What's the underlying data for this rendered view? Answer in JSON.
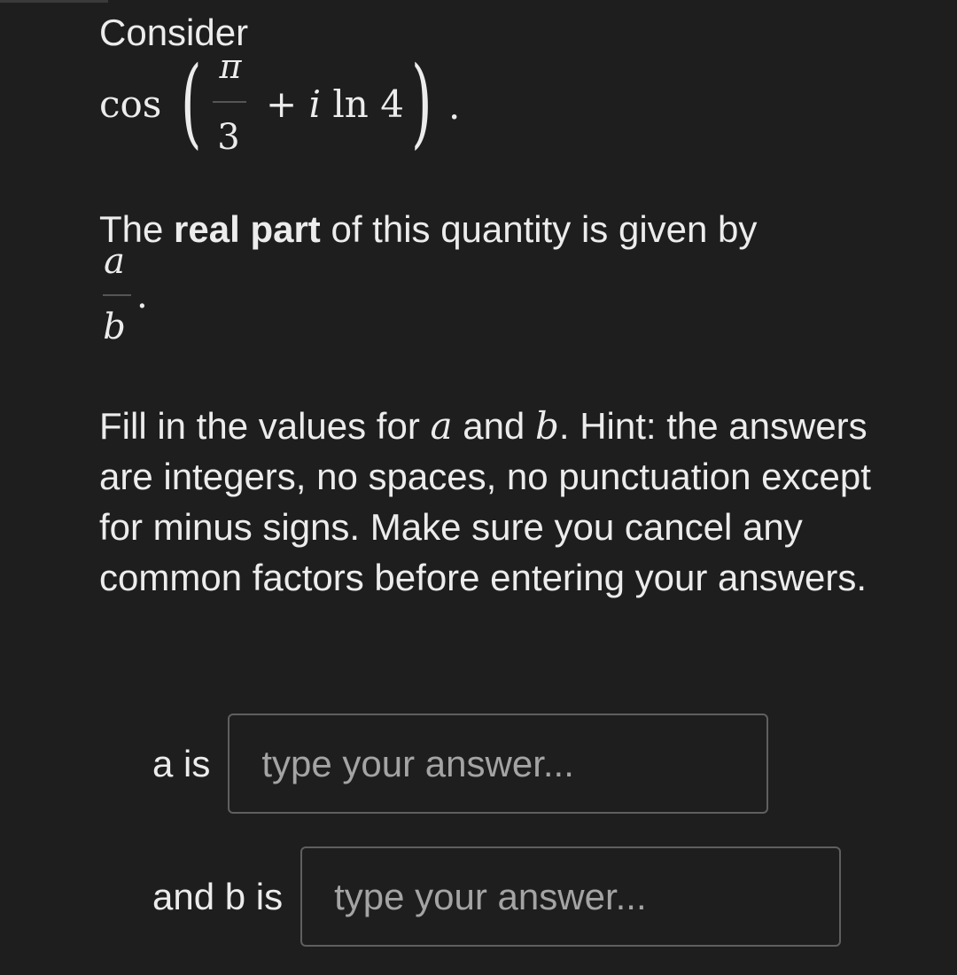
{
  "question": {
    "intro": "Consider",
    "expression": {
      "func": "cos",
      "numerator": "π",
      "denominator": "3",
      "plus": "+",
      "imag": "i",
      "log": "ln",
      "log_arg": "4",
      "terminator": "."
    },
    "real_part_sentence": {
      "pre": "The ",
      "bold": "real part",
      "post": " of this quantity is given by"
    },
    "fraction": {
      "numerator": "a",
      "denominator": "b",
      "terminator": "."
    },
    "instructions": {
      "part1": "Fill in the values for ",
      "var_a": "a",
      "part2": " and ",
      "var_b": "b",
      "part3": ". Hint: the answers are integers, no spaces, no punctuation except for minus signs. Make sure you cancel any common factors before entering your answers."
    }
  },
  "answers": [
    {
      "label": "a is",
      "placeholder": "type your answer...",
      "value": ""
    },
    {
      "label": "and b is",
      "placeholder": "type your answer...",
      "value": ""
    }
  ]
}
